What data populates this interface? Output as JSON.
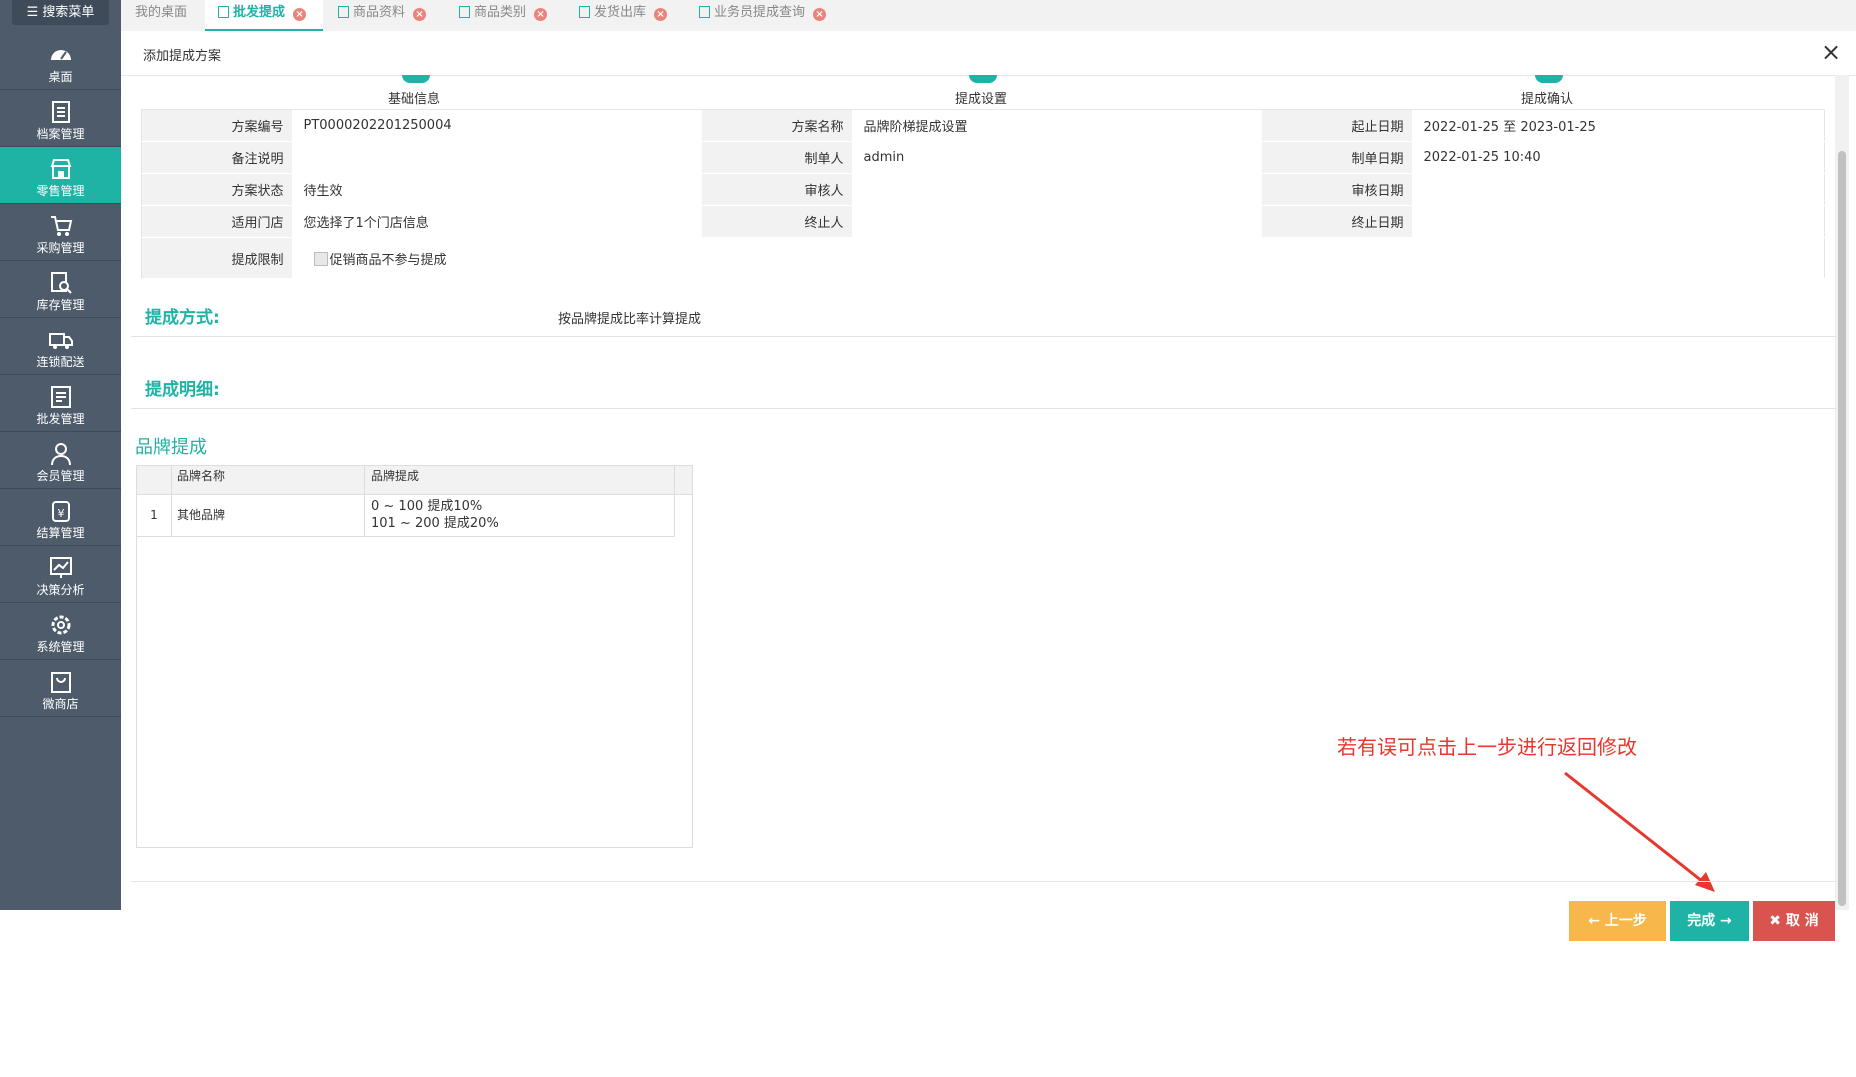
{
  "sidebar": {
    "search_label": "搜索菜单",
    "items": [
      {
        "label": "桌面",
        "icon": "dashboard-icon"
      },
      {
        "label": "档案管理",
        "icon": "archive-icon"
      },
      {
        "label": "零售管理",
        "icon": "store-icon",
        "active": true
      },
      {
        "label": "采购管理",
        "icon": "cart-icon"
      },
      {
        "label": "库存管理",
        "icon": "inventory-search-icon"
      },
      {
        "label": "连锁配送",
        "icon": "truck-icon"
      },
      {
        "label": "批发管理",
        "icon": "wholesale-icon"
      },
      {
        "label": "会员管理",
        "icon": "user-icon"
      },
      {
        "label": "结算管理",
        "icon": "yen-icon"
      },
      {
        "label": "决策分析",
        "icon": "chart-icon"
      },
      {
        "label": "系统管理",
        "icon": "gear-icon"
      },
      {
        "label": "微商店",
        "icon": "shop-bag-icon"
      }
    ]
  },
  "tabs": [
    {
      "label": "我的桌面",
      "closable": false
    },
    {
      "label": "批发提成",
      "closable": true,
      "active": true
    },
    {
      "label": "商品资料",
      "closable": true
    },
    {
      "label": "商品类别",
      "closable": true
    },
    {
      "label": "发货出库",
      "closable": true
    },
    {
      "label": "业务员提成查询",
      "closable": true
    }
  ],
  "dialog": {
    "title": "添加提成方案",
    "close_glyph": "×",
    "steps": [
      "基础信息",
      "提成设置",
      "提成确认"
    ],
    "info": {
      "plan_no_label": "方案编号",
      "plan_no": "PT0000202201250004",
      "plan_name_label": "方案名称",
      "plan_name": "品牌阶梯提成设置",
      "date_range_label": "起止日期",
      "date_range": "2022-01-25 至 2023-01-25",
      "remark_label": "备注说明",
      "remark": "",
      "creator_label": "制单人",
      "creator": "admin",
      "created_date_label": "制单日期",
      "created_date": "2022-01-25 10:40",
      "status_label": "方案状态",
      "status": "待生效",
      "auditor_label": "审核人",
      "auditor": "",
      "audit_date_label": "审核日期",
      "audit_date": "",
      "stores_label": "适用门店",
      "stores": "您选择了1个门店信息",
      "terminator_label": "终止人",
      "terminator": "",
      "end_date_label": "终止日期",
      "end_date": "",
      "limit_label": "提成限制",
      "limit_checkbox_label": "促销商品不参与提成"
    },
    "method_title": "提成方式:",
    "method_value": "按品牌提成比率计算提成",
    "detail_title": "提成明细:",
    "brand_section_title": "品牌提成",
    "brand_table": {
      "headers": [
        "品牌名称",
        "品牌提成"
      ],
      "rows": [
        {
          "index": "1",
          "brand": "其他品牌",
          "tier1": "0 ~ 100 提成10%",
          "tier2": "101 ~ 200 提成20%"
        }
      ]
    },
    "annotation": "若有误可点击上一步进行返回修改",
    "buttons": {
      "prev": "← 上一步",
      "done": "完成 →",
      "cancel": "✖ 取 消"
    }
  },
  "colors": {
    "accent": "#1fb3a5",
    "sidebar": "#4d5b6b",
    "prev": "#f7b74a",
    "cancel": "#d9534f",
    "annotation": "#e8372c"
  }
}
